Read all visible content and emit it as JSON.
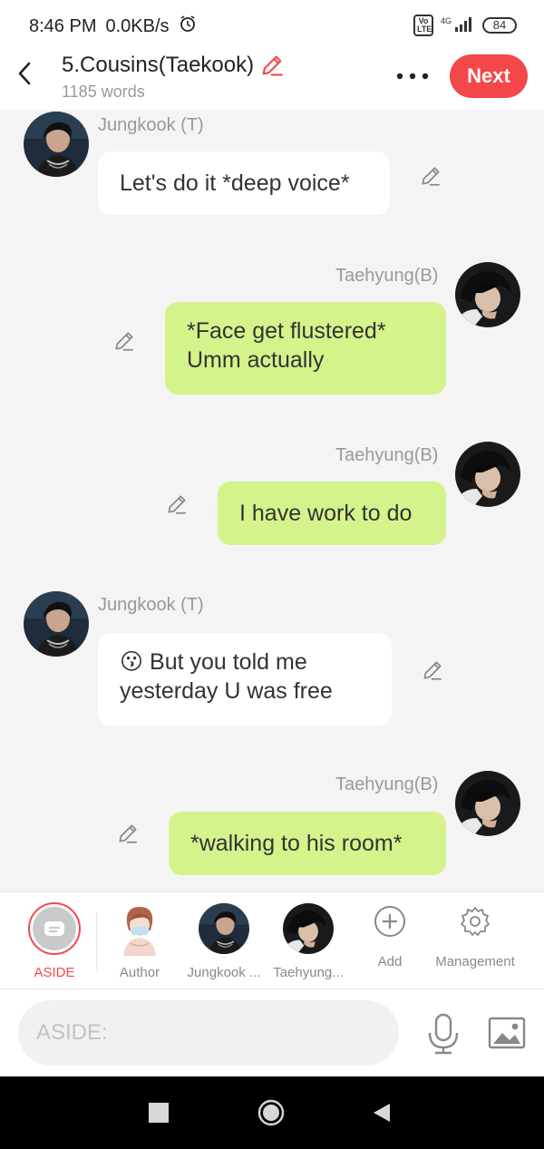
{
  "status": {
    "time": "8:46 PM",
    "speed": "0.0KB/s",
    "volte": "Vo LTE",
    "network": "4G",
    "battery": "84"
  },
  "header": {
    "title": "5.Cousins(Taekook)",
    "word_count": "1185 words",
    "next_label": "Next"
  },
  "messages": [
    {
      "side": "left",
      "sender": "Jungkook (T)",
      "text": "Let's do it *deep voice*"
    },
    {
      "side": "right",
      "sender": "Taehyung(B)",
      "text": "*Face get flustered* Umm actually"
    },
    {
      "side": "right",
      "sender": "Taehyung(B)",
      "text": "I have work to do"
    },
    {
      "side": "left",
      "sender": "Jungkook (T)",
      "emoji": "😗",
      "text": "But you told me yesterday U was free"
    },
    {
      "side": "right",
      "sender": "Taehyung(B)",
      "text": "*walking to his room*"
    }
  ],
  "toolbar": {
    "aside": "ASIDE",
    "author": "Author",
    "jungkook": "Jungkook ...",
    "taehyung": "Taehyung...",
    "add": "Add",
    "management": "Management"
  },
  "input": {
    "placeholder": "ASIDE:"
  },
  "colors": {
    "accent": "#f4474a",
    "right_bubble": "#d5f38b",
    "left_bubble": "#ffffff",
    "background": "#f4f4f4"
  }
}
